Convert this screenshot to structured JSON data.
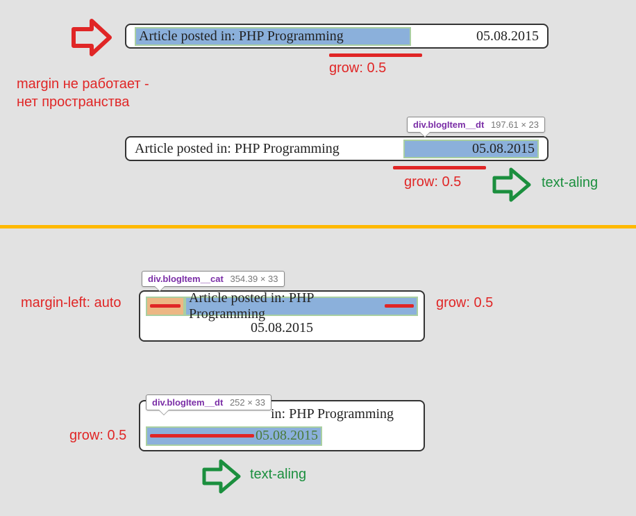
{
  "colors": {
    "red": "#e02626",
    "green": "#1b8f3e",
    "orange_divider": "#ffb900"
  },
  "box1": {
    "article_text": "Article posted in: PHP Programming",
    "date": "05.08.2015"
  },
  "box1_labels": {
    "grow": "grow: 0.5",
    "margin_line1": "margin не работает -",
    "margin_line2": "нет пространства"
  },
  "box2": {
    "article_text": "Article posted in: PHP Programming",
    "date": "05.08.2015"
  },
  "box2_tooltip": {
    "selector": "div.blogItem__dt",
    "dimensions": "197.61 × 23"
  },
  "box2_labels": {
    "grow": "grow: 0.5",
    "text_align": "text-aling"
  },
  "box3": {
    "article_text": "Article posted in: PHP Programming",
    "date": "05.08.2015"
  },
  "box3_tooltip": {
    "selector": "div.blogItem__cat",
    "dimensions": "354.39 × 33"
  },
  "box3_labels": {
    "margin_left": "margin-left: auto",
    "grow": "grow: 0.5"
  },
  "box4": {
    "article_text_prefix": "in: PHP Programming",
    "date": "05.08.2015"
  },
  "box4_tooltip": {
    "selector": "div.blogItem__dt",
    "dimensions": "252 × 33"
  },
  "box4_labels": {
    "grow": "grow: 0.5",
    "text_align": "text-aling"
  }
}
